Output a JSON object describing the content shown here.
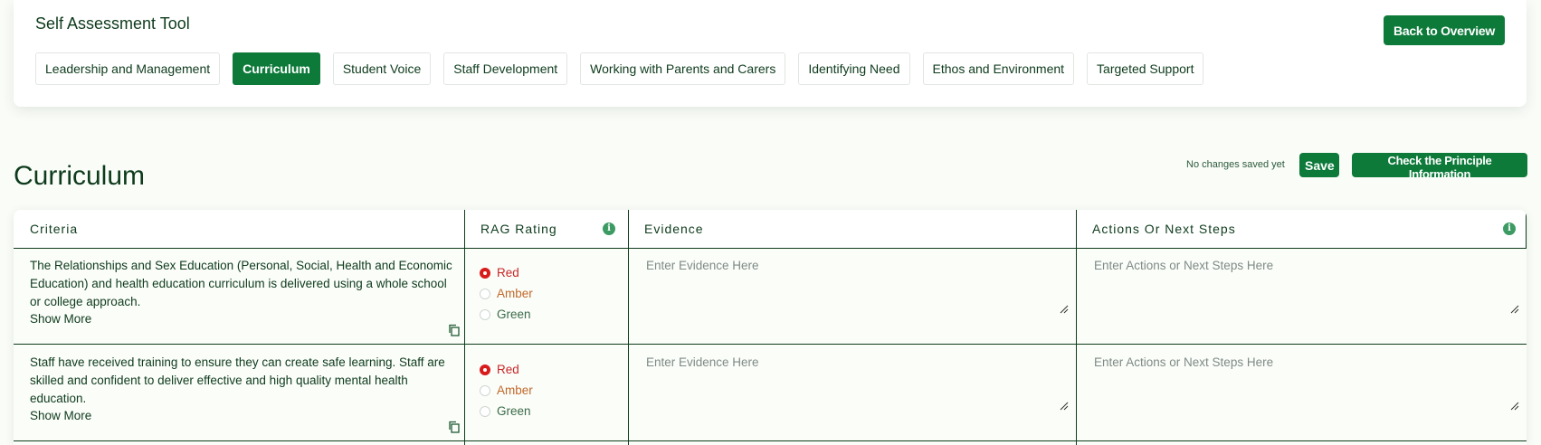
{
  "header": {
    "tool_title": "Self Assessment Tool",
    "back_button": "Back to Overview",
    "tabs": [
      {
        "label": "Leadership and Management",
        "active": false
      },
      {
        "label": "Curriculum",
        "active": true
      },
      {
        "label": "Student Voice",
        "active": false
      },
      {
        "label": "Staff Development",
        "active": false
      },
      {
        "label": "Working with Parents and Carers",
        "active": false
      },
      {
        "label": "Identifying Need",
        "active": false
      },
      {
        "label": "Ethos and Environment",
        "active": false
      },
      {
        "label": "Targeted Support",
        "active": false
      }
    ]
  },
  "page": {
    "title": "Curriculum",
    "save_status": "No changes saved yet",
    "save_button": "Save",
    "principle_button": "Check the Principle Information"
  },
  "table": {
    "columns": {
      "criteria": "Criteria",
      "rag": "RAG Rating",
      "evidence": "Evidence",
      "actions": "Actions Or Next Steps"
    },
    "rag_options": {
      "red": "Red",
      "amber": "Amber",
      "green": "Green"
    },
    "rows": [
      {
        "criteria": "The Relationships and Sex Education (Personal, Social, Health and Economic Education) and health education curriculum is delivered using a whole school or college approach.",
        "show_more": "Show More",
        "rag_selected": "Red",
        "evidence_placeholder": "Enter Evidence Here",
        "actions_placeholder": "Enter Actions or Next Steps Here"
      },
      {
        "criteria": "Staff have received training to ensure they can create safe learning. Staff are skilled and confident to deliver effective and high quality mental health education.",
        "show_more": "Show More",
        "rag_selected": "Red",
        "evidence_placeholder": "Enter Evidence Here",
        "actions_placeholder": "Enter Actions or Next Steps Here"
      }
    ]
  },
  "colors": {
    "primary": "#0d7a3a",
    "text": "#0e3b1c",
    "rag_red": "#c62828",
    "rag_amber": "#c0692a",
    "rag_green": "#3b6b48"
  }
}
